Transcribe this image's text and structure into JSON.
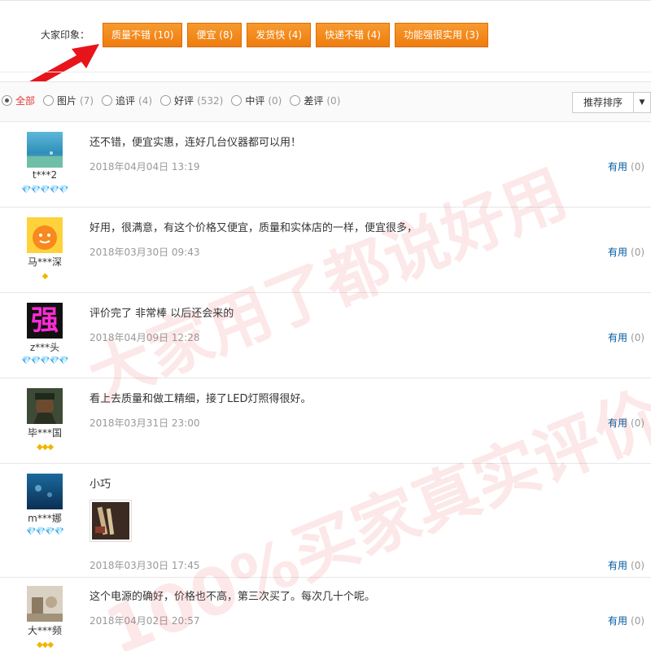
{
  "impressions": {
    "label": "大家印象：",
    "tags": [
      {
        "text": "质量不错 (10)"
      },
      {
        "text": "便宜 (8)"
      },
      {
        "text": "发货快 (4)"
      },
      {
        "text": "快递不错 (4)"
      },
      {
        "text": "功能强很实用 (3)"
      }
    ]
  },
  "filter": {
    "options": [
      {
        "label": "全部",
        "count": "",
        "selected": true
      },
      {
        "label": "图片",
        "count": "(7)",
        "selected": false
      },
      {
        "label": "追评",
        "count": "(4)",
        "selected": false
      },
      {
        "label": "好评",
        "count": "(532)",
        "selected": false
      },
      {
        "label": "中评",
        "count": "(0)",
        "selected": false
      },
      {
        "label": "差评",
        "count": "(0)",
        "selected": false
      }
    ],
    "sort_label": "推荐排序",
    "sort_caret": "▼"
  },
  "reviews": [
    {
      "user": "t***2",
      "gems": "💎💎💎💎💎",
      "gem_type": "red",
      "text": "还不错，便宜实惠，连好几台仪器都可以用！",
      "date": "2018年04月04日 13:19",
      "useful": "有用",
      "useful_count": "(0)",
      "avatar": "sky-avatar"
    },
    {
      "user": "马***深",
      "gems": "◆",
      "gem_type": "gold",
      "text": "好用，很满意，有这个价格又便宜，质量和实体店的一样，便宜很多，",
      "date": "2018年03月30日 09:43",
      "useful": "有用",
      "useful_count": "(0)",
      "avatar": "orange-face-avatar"
    },
    {
      "user": "z***头",
      "gems": "💎💎💎💎💎",
      "gem_type": "red",
      "text": "评价完了 非常棒 以后还会来的",
      "date": "2018年04月09日 12:28",
      "useful": "有用",
      "useful_count": "(0)",
      "avatar": "qiang-avatar",
      "avatar_text": "强"
    },
    {
      "user": "毕***国",
      "gems": "◆◆◆",
      "gem_type": "gold",
      "text": "看上去质量和做工精细，接了LED灯照得很好。",
      "date": "2018年03月31日 23:00",
      "useful": "有用",
      "useful_count": "(0)",
      "avatar": "warrior-avatar"
    },
    {
      "user": "m***娜",
      "gems": "💎💎💎💎",
      "gem_type": "red",
      "text": "小巧",
      "date": "2018年03月30日 17:45",
      "useful": "有用",
      "useful_count": "(0)",
      "avatar": "underwater-avatar",
      "has_image": true
    },
    {
      "user": "大***频",
      "gems": "◆◆◆",
      "gem_type": "gold",
      "text": "这个电源的确好，价格也不高，第三次买了。每次几十个呢。",
      "date": "2018年04月02日 20:57",
      "useful": "有用",
      "useful_count": "(0)",
      "avatar": "room-avatar"
    }
  ],
  "watermark": {
    "line1": "大家用了都说好用",
    "line2": "100%买家真实评价"
  },
  "colors": {
    "tag_orange": "#f08a1e",
    "active_red": "#e4393c",
    "link_blue": "#005aa0",
    "arrow_red": "#e8141b"
  }
}
